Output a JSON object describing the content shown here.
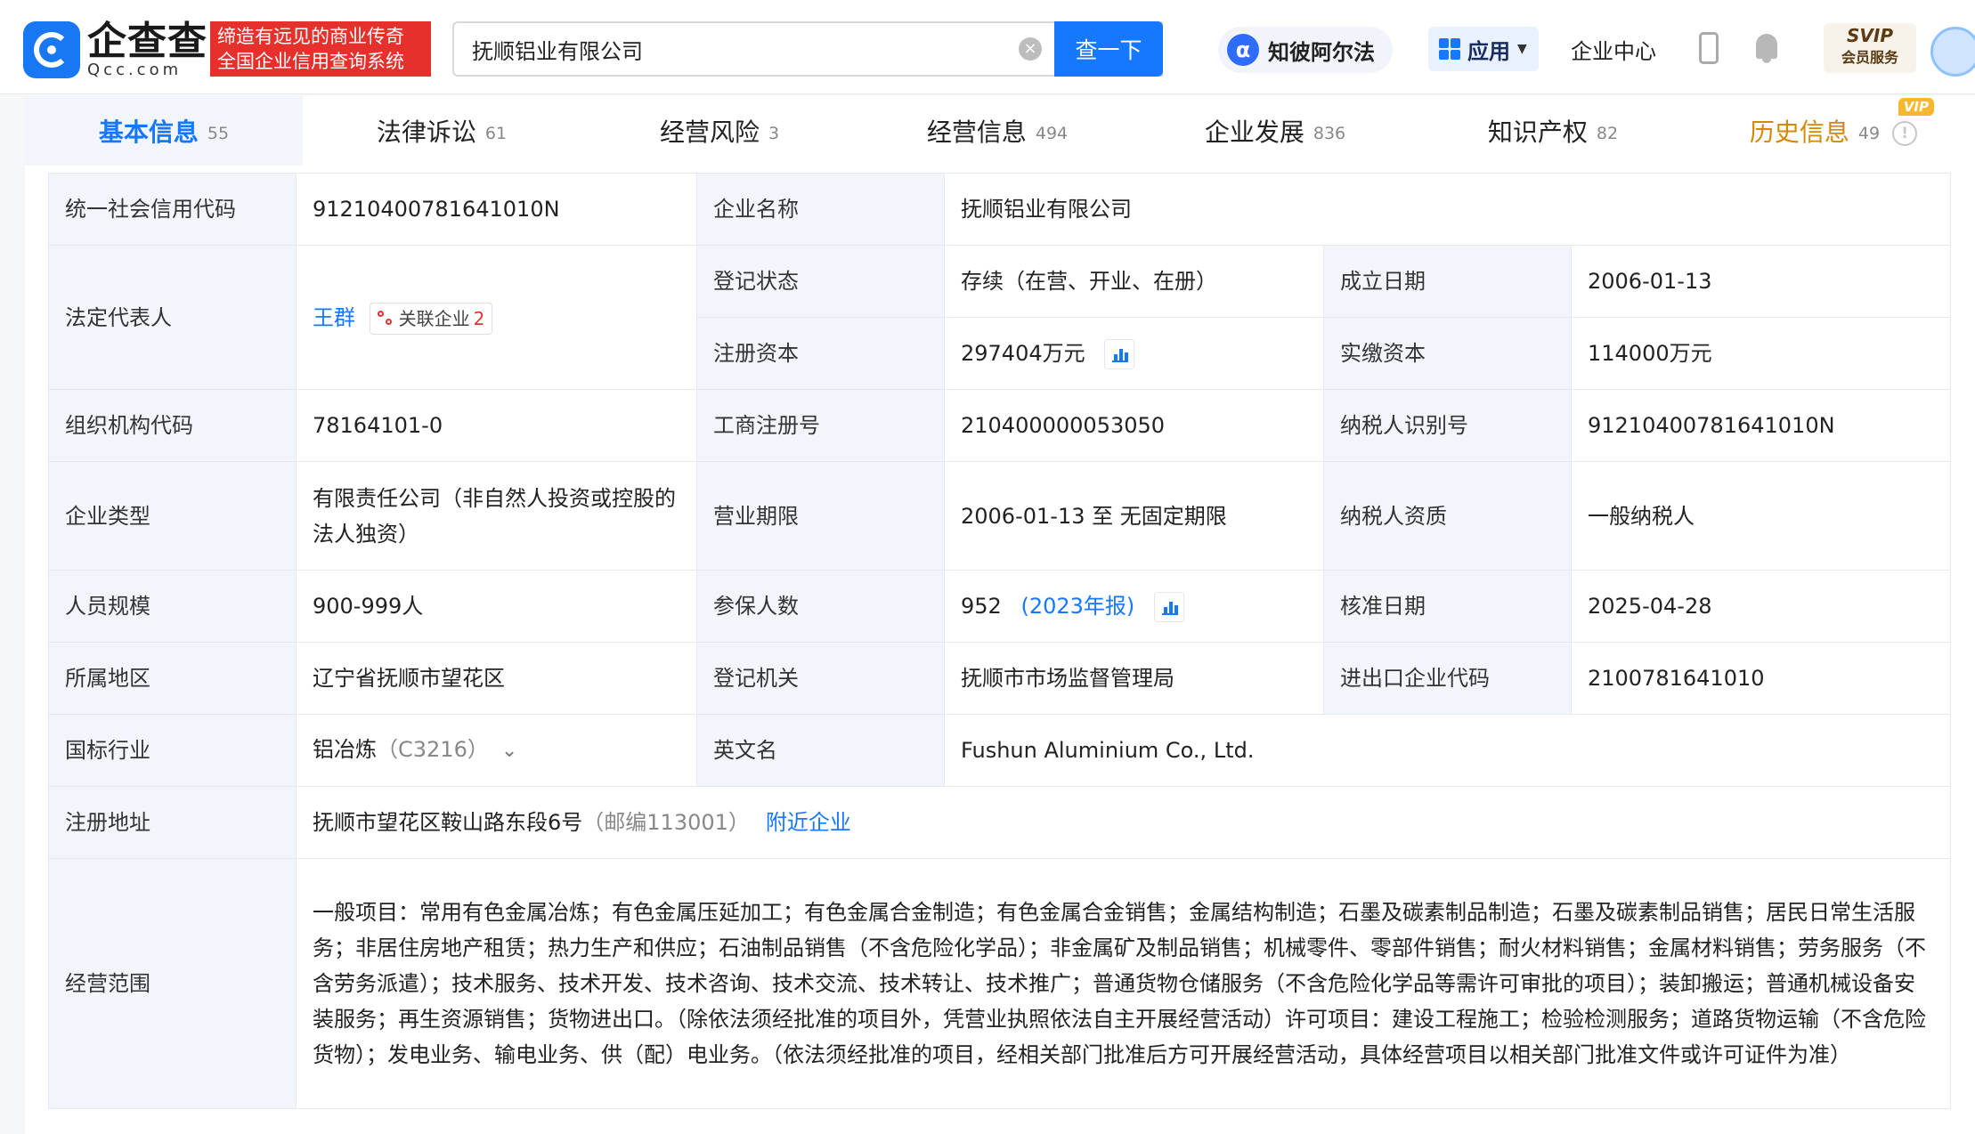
{
  "header": {
    "logo_cn": "企查查",
    "logo_en": "Qcc.com",
    "slogan_line1": "缔造有远见的商业传奇",
    "slogan_line2": "全国企业信用查询系统",
    "search_value": "抚顺铝业有限公司",
    "search_button": "查一下",
    "alpha_label": "知彼阿尔法",
    "alpha_icon": "α",
    "apps_label": "应用",
    "enterprise_center": "企业中心",
    "svip_top": "SVIP",
    "svip_bottom": "会员服务",
    "icons": [
      "search-clear-icon",
      "alpha-icon",
      "grid-icon",
      "phone-icon",
      "bell-icon",
      "avatar"
    ]
  },
  "tabs": [
    {
      "label": "基本信息",
      "count": "55",
      "active": true
    },
    {
      "label": "法律诉讼",
      "count": "61"
    },
    {
      "label": "经营风险",
      "count": "3"
    },
    {
      "label": "经营信息",
      "count": "494"
    },
    {
      "label": "企业发展",
      "count": "836"
    },
    {
      "label": "知识产权",
      "count": "82"
    },
    {
      "label": "历史信息",
      "count": "49",
      "badge": "VIP"
    }
  ],
  "info": {
    "credit_code_label": "统一社会信用代码",
    "credit_code": "91210400781641010N",
    "company_name_label": "企业名称",
    "company_name": "抚顺铝业有限公司",
    "legal_rep_label": "法定代表人",
    "legal_rep": "王群",
    "related_label": "关联企业",
    "related_count": "2",
    "reg_status_label": "登记状态",
    "reg_status": "存续（在营、开业、在册）",
    "founded_label": "成立日期",
    "founded": "2006-01-13",
    "reg_capital_label": "注册资本",
    "reg_capital": "297404万元",
    "paid_capital_label": "实缴资本",
    "paid_capital": "114000万元",
    "org_code_label": "组织机构代码",
    "org_code": "78164101-0",
    "biz_reg_no_label": "工商注册号",
    "biz_reg_no": "210400000053050",
    "taxpayer_id_label": "纳税人识别号",
    "taxpayer_id": "91210400781641010N",
    "company_type_label": "企业类型",
    "company_type": "有限责任公司（非自然人投资或控股的法人独资）",
    "biz_term_label": "营业期限",
    "biz_term": "2006-01-13 至 无固定期限",
    "taxpayer_qual_label": "纳税人资质",
    "taxpayer_qual": "一般纳税人",
    "staff_size_label": "人员规模",
    "staff_size": "900-999人",
    "insured_label": "参保人数",
    "insured": "952",
    "insured_year": "(2023年报)",
    "approval_date_label": "核准日期",
    "approval_date": "2025-04-28",
    "region_label": "所属地区",
    "region": "辽宁省抚顺市望花区",
    "reg_authority_label": "登记机关",
    "reg_authority": "抚顺市市场监督管理局",
    "ie_code_label": "进出口企业代码",
    "ie_code": "2100781641010",
    "industry_label": "国标行业",
    "industry": "铝冶炼",
    "industry_code": "（C3216）",
    "english_name_label": "英文名",
    "english_name": "Fushun Aluminium Co., Ltd.",
    "address_label": "注册地址",
    "address": "抚顺市望花区鞍山路东段6号",
    "postcode": "（邮编113001）",
    "nearby_link": "附近企业",
    "scope_label": "经营范围",
    "scope": "一般项目：常用有色金属冶炼；有色金属压延加工；有色金属合金制造；有色金属合金销售；金属结构制造；石墨及碳素制品制造；石墨及碳素制品销售；居民日常生活服务；非居住房地产租赁；热力生产和供应；石油制品销售（不含危险化学品）；非金属矿及制品销售；机械零件、零部件销售；耐火材料销售；金属材料销售；劳务服务（不含劳务派遣）；技术服务、技术开发、技术咨询、技术交流、技术转让、技术推广；普通货物仓储服务（不含危险化学品等需许可审批的项目）；装卸搬运；普通机械设备安装服务；再生资源销售；货物进出口。（除依法须经批准的项目外，凭营业执照依法自主开展经营活动）许可项目：建设工程施工；检验检测服务；道路货物运输（不含危险货物）；发电业务、输电业务、供（配）电业务。（依法须经批准的项目，经相关部门批准后方可开展经营活动，具体经营项目以相关部门批准文件或许可证件为准）"
  },
  "colors": {
    "brand_blue": "#1677ff",
    "slogan_red": "#e5302c",
    "label_bg": "#f2f6fc",
    "history_gold": "#d48806"
  }
}
